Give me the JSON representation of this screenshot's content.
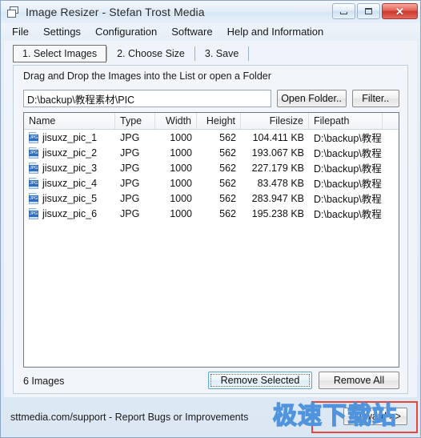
{
  "window": {
    "title": "Image Resizer - Stefan Trost Media",
    "icon": "cascading-windows-icon",
    "controls": {
      "minimize": "–",
      "maximize": "□",
      "close": "✕"
    }
  },
  "menu": {
    "items": [
      {
        "label": "File"
      },
      {
        "label": "Settings"
      },
      {
        "label": "Configuration"
      },
      {
        "label": "Software"
      },
      {
        "label": "Help and Information"
      }
    ]
  },
  "tabs": [
    {
      "label": "1. Select Images",
      "active": true
    },
    {
      "label": "2. Choose Size",
      "active": false
    },
    {
      "label": "3. Save",
      "active": false
    }
  ],
  "panel": {
    "hint": "Drag and Drop the Images into the List or open a Folder",
    "path_value": "D:\\backup\\教程素材\\PIC",
    "path_placeholder": "",
    "open_folder_label": "Open Folder..",
    "filter_label": "Filter.."
  },
  "listview": {
    "columns": [
      "Name",
      "Type",
      "Width",
      "Height",
      "Filesize",
      "Filepath"
    ],
    "rows": [
      {
        "name": "jisuxz_pic_1",
        "type": "JPG",
        "width": "1000",
        "height": "562",
        "filesize": "104.411 KB",
        "filepath": "D:\\backup\\教程..."
      },
      {
        "name": "jisuxz_pic_2",
        "type": "JPG",
        "width": "1000",
        "height": "562",
        "filesize": "193.067 KB",
        "filepath": "D:\\backup\\教程..."
      },
      {
        "name": "jisuxz_pic_3",
        "type": "JPG",
        "width": "1000",
        "height": "562",
        "filesize": "227.179 KB",
        "filepath": "D:\\backup\\教程..."
      },
      {
        "name": "jisuxz_pic_4",
        "type": "JPG",
        "width": "1000",
        "height": "562",
        "filesize": "83.478 KB",
        "filepath": "D:\\backup\\教程..."
      },
      {
        "name": "jisuxz_pic_5",
        "type": "JPG",
        "width": "1000",
        "height": "562",
        "filesize": "283.947 KB",
        "filepath": "D:\\backup\\教程..."
      },
      {
        "name": "jisuxz_pic_6",
        "type": "JPG",
        "width": "1000",
        "height": "562",
        "filesize": "195.238 KB",
        "filepath": "D:\\backup\\教程..."
      }
    ],
    "file_icon_badge": "JPG"
  },
  "panel_footer": {
    "image_count": "6 Images",
    "remove_selected_label": "Remove Selected",
    "remove_all_label": "Remove All"
  },
  "statusbar": {
    "text": "sttmedia.com/support - Report Bugs or Improvements",
    "forward_label": "Forward >>"
  },
  "watermark": {
    "text": "极速下载站",
    "border_color": "#e8453c",
    "text_color": "#4f94dd"
  }
}
